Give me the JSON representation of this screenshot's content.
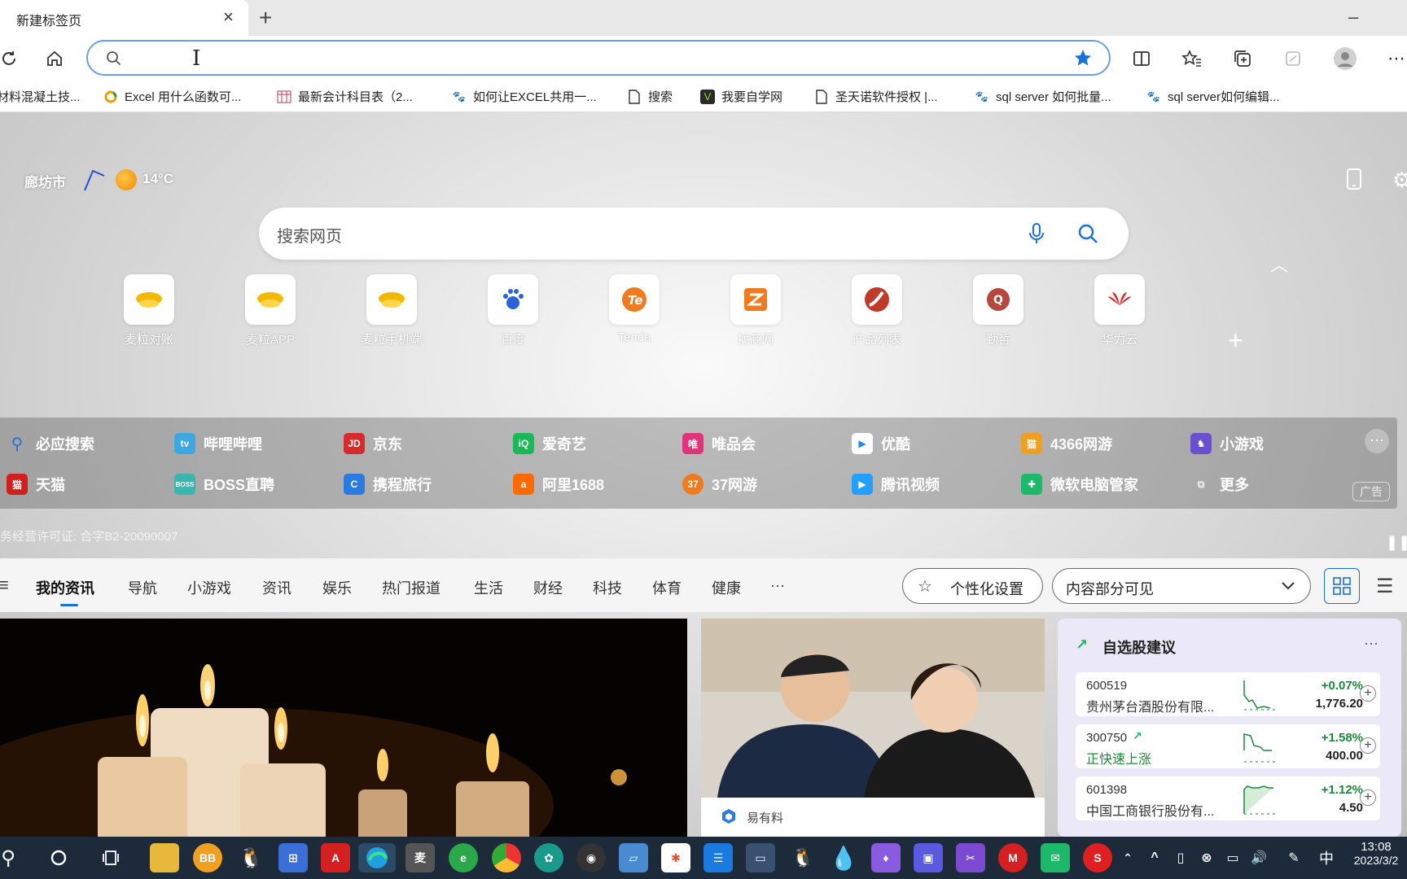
{
  "tab": {
    "title": "新建标签页",
    "close": "×",
    "new_tab": "+"
  },
  "window": {
    "minimize": "–"
  },
  "toolbar": {
    "address_value": "",
    "cursor": "I"
  },
  "bookmarks": [
    {
      "label": "材料混凝土技...",
      "icon": "page-icon"
    },
    {
      "label": "Excel 用什么函数可...",
      "icon": "ring-icon"
    },
    {
      "label": "最新会计科目表（2...",
      "icon": "table-icon"
    },
    {
      "label": "如何让EXCEL共用一...",
      "icon": "baidu-paw-icon"
    },
    {
      "label": "搜索",
      "icon": "page-icon"
    },
    {
      "label": "我要自学网",
      "icon": "v-logo-icon"
    },
    {
      "label": "圣天诺软件授权 |...",
      "icon": "page-icon"
    },
    {
      "label": "sql server 如何批量...",
      "icon": "baidu-paw-icon"
    },
    {
      "label": "sql server如何编辑...",
      "icon": "baidu-paw-icon"
    }
  ],
  "weather": {
    "city": "廊坊市",
    "temp": "14°C"
  },
  "search": {
    "placeholder": "搜索网页"
  },
  "tiles": [
    {
      "label": "麦粒对账"
    },
    {
      "label": "麦粒APP"
    },
    {
      "label": "麦粒手机端"
    },
    {
      "label": "百度"
    },
    {
      "label": "Tenda"
    },
    {
      "label": "找商网"
    },
    {
      "label": "产品列表"
    },
    {
      "label": "勤哲"
    },
    {
      "label": "华为云"
    }
  ],
  "tile_add": "+",
  "quicklinks": [
    {
      "label": "必应搜索",
      "color": "#2a6fd6",
      "glyph": "🔍"
    },
    {
      "label": "哔哩哔哩",
      "color": "#3ea6e0",
      "glyph": "tv"
    },
    {
      "label": "京东",
      "color": "#d62b2b",
      "glyph": "JD"
    },
    {
      "label": "爱奇艺",
      "color": "#19b955",
      "glyph": "iQ"
    },
    {
      "label": "唯品会",
      "color": "#e0337a",
      "glyph": "唯"
    },
    {
      "label": "优酷",
      "color": "#1e8cf0",
      "glyph": "▶"
    },
    {
      "label": "4366网游",
      "color": "#f0a020",
      "glyph": "猫"
    },
    {
      "label": "小游戏",
      "color": "#6a4fd0",
      "glyph": "♞"
    },
    {
      "label": "天猫",
      "color": "#d0201e",
      "glyph": "猫"
    },
    {
      "label": "BOSS直聘",
      "color": "#3bb5b0",
      "glyph": "BOSS"
    },
    {
      "label": "携程旅行",
      "color": "#2a7ae0",
      "glyph": "C"
    },
    {
      "label": "阿里1688",
      "color": "#ff6a00",
      "glyph": "a"
    },
    {
      "label": "37网游",
      "color": "#f07b1e",
      "glyph": "37"
    },
    {
      "label": "腾讯视频",
      "color": "#22a0ff",
      "glyph": "▶"
    },
    {
      "label": "微软电脑管家",
      "color": "#1db86a",
      "glyph": "✚"
    },
    {
      "label": "更多",
      "color": "transparent",
      "glyph": "⧉"
    }
  ],
  "ad_label": "广告",
  "license": "务经营许可证: 合字B2-20090007",
  "feed_tabs": [
    "我的资讯",
    "导航",
    "小游戏",
    "资讯",
    "娱乐",
    "热门报道",
    "生活",
    "财经",
    "科技",
    "体育",
    "健康",
    "···"
  ],
  "personalize": "个性化设置",
  "visibility": "内容部分可见",
  "news_card": {
    "source": "易有料"
  },
  "stocks": {
    "title": "自选股建议",
    "items": [
      {
        "code": "600519",
        "name": "贵州茅台酒股份有限...",
        "change": "+0.07%",
        "price": "1,776.20"
      },
      {
        "code": "300750",
        "name": "正快速上涨",
        "change": "+1.58%",
        "price": "400.00"
      },
      {
        "code": "601398",
        "name": "中国工商银行股份有...",
        "change": "+1.12%",
        "price": "4.50"
      }
    ]
  },
  "clock": {
    "time": "13:08",
    "date": "2023/3/2"
  },
  "ime": "中"
}
